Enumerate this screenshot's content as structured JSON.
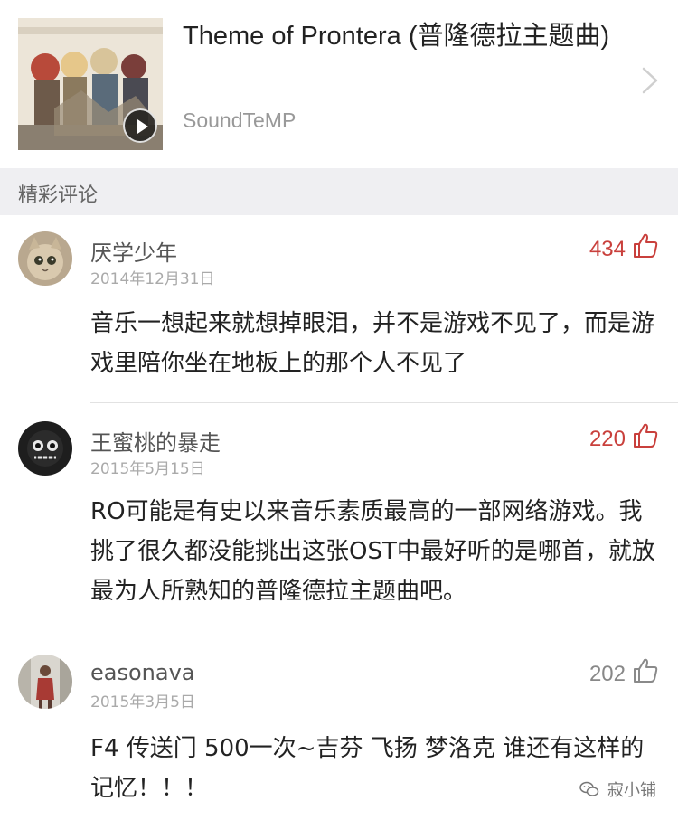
{
  "song": {
    "title": "Theme of Prontera (普隆德拉主题曲)",
    "artist": "SoundTeMP"
  },
  "icons": {
    "play": "play-icon",
    "chevron": "chevron-right-icon",
    "like": "thumbs-up-icon",
    "watermark": "wechat-icon"
  },
  "colors": {
    "hot_like": "#c9403c",
    "normal_like": "#888888",
    "section_bg": "#efeff2"
  },
  "section": {
    "title": "精彩评论"
  },
  "comments": [
    {
      "username": "厌学少年",
      "date": "2014年12月31日",
      "likes": "434",
      "text": "音乐一想起来就想掉眼泪，并不是游戏不见了，而是游戏里陪你坐在地板上的那个人不见了"
    },
    {
      "username": "王蜜桃的暴走",
      "date": "2015年5月15日",
      "likes": "220",
      "text": "RO可能是有史以来音乐素质最高的一部网络游戏。我挑了很久都没能挑出这张OST中最好听的是哪首，就放最为人所熟知的普隆德拉主题曲吧。"
    },
    {
      "username": "easonava",
      "date": "2015年3月5日",
      "likes": "202",
      "text": "F4 传送门 500一次~吉芬 飞扬 梦洛克 谁还有这样的记忆！！！"
    }
  ],
  "watermark": {
    "text": "寂小铺"
  }
}
